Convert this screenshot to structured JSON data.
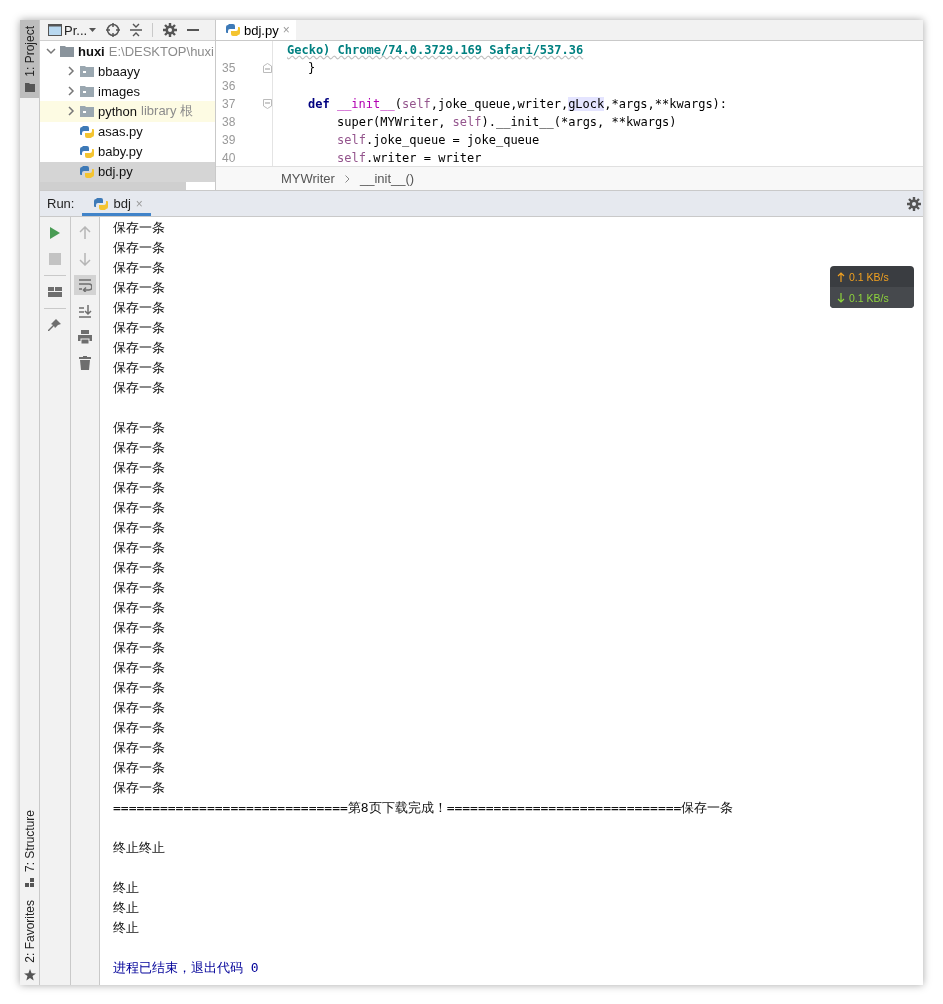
{
  "side_strip": {
    "top": [
      {
        "label": "1: Project",
        "selected": true
      }
    ],
    "bottom": [
      {
        "label": "7: Structure",
        "selected": false
      },
      {
        "label": "2: Favorites",
        "selected": false
      }
    ]
  },
  "project_panel": {
    "title": "Pr...",
    "tree": [
      {
        "name": "huxi",
        "path": "E:\\DESKTOP\\huxi",
        "kind": "folder",
        "expanded": true,
        "selected": false,
        "highlighted": false,
        "children": [
          {
            "name": "bbaayy",
            "kind": "folder",
            "expanded": false,
            "selected": false,
            "highlighted": false
          },
          {
            "name": "images",
            "kind": "folder",
            "expanded": false,
            "selected": false,
            "highlighted": false
          },
          {
            "name": "python",
            "note": "library 根",
            "kind": "folder",
            "expanded": false,
            "selected": false,
            "highlighted": true
          },
          {
            "name": "asas.py",
            "kind": "python-file",
            "selected": false,
            "highlighted": false
          },
          {
            "name": "baby.py",
            "kind": "python-file",
            "selected": false,
            "highlighted": false
          },
          {
            "name": "bdj.py",
            "kind": "python-file",
            "selected": true,
            "highlighted": false
          }
        ]
      }
    ]
  },
  "editor": {
    "tab": {
      "label": "bdj.py",
      "close": "×"
    },
    "lines": [
      {
        "kind": "continuation",
        "tokens": [
          {
            "kind": "string",
            "text": "Gecko) Chrome/74.0.3729.169 Safari/537.36"
          }
        ]
      },
      {
        "number": "35",
        "kind": "block-end",
        "tokens": [
          {
            "kind": "plain",
            "text": "}"
          }
        ]
      },
      {
        "number": "36",
        "kind": "blank"
      },
      {
        "number": "37",
        "kind": "def",
        "tokens": [
          {
            "kind": "keyword",
            "text": "def "
          },
          {
            "kind": "magic",
            "text": "__init__"
          },
          {
            "kind": "plain",
            "text": "("
          },
          {
            "kind": "self",
            "text": "self"
          },
          {
            "kind": "plain",
            "text": ",joke_queue,writer,"
          },
          {
            "kind": "highlight",
            "text": "gLock"
          },
          {
            "kind": "plain",
            "text": ",*args,**kwargs):"
          }
        ]
      },
      {
        "number": "38",
        "kind": "body",
        "tokens": [
          {
            "kind": "plain",
            "text": "super(MYWriter, "
          },
          {
            "kind": "self",
            "text": "self"
          },
          {
            "kind": "plain",
            "text": ").__init__(*args, **kwargs)"
          }
        ]
      },
      {
        "number": "39",
        "kind": "body",
        "tokens": [
          {
            "kind": "self",
            "text": "self"
          },
          {
            "kind": "plain",
            "text": ".joke_queue = joke_queue"
          }
        ]
      },
      {
        "number": "40",
        "kind": "body",
        "tokens": [
          {
            "kind": "self",
            "text": "self"
          },
          {
            "kind": "plain",
            "text": ".writer = writer"
          }
        ]
      }
    ],
    "breadcrumbs": [
      "MYWriter",
      "__init__()"
    ]
  },
  "run_panel": {
    "label": "Run:",
    "tab": {
      "label": "bdj",
      "close": "×",
      "selected": true
    },
    "tools_left": [
      {
        "kind": "run",
        "disabled": false
      },
      {
        "kind": "stop",
        "disabled": true
      },
      {
        "kind": "layout",
        "disabled": false
      },
      {
        "kind": "pin",
        "disabled": false
      }
    ],
    "tools_right": [
      {
        "kind": "up",
        "disabled": true,
        "on": false
      },
      {
        "kind": "down",
        "disabled": true,
        "on": false
      },
      {
        "kind": "wrap",
        "disabled": false,
        "on": true
      },
      {
        "kind": "scroll-end",
        "disabled": false,
        "on": false
      },
      {
        "kind": "print",
        "disabled": false,
        "on": false
      },
      {
        "kind": "trash",
        "disabled": false,
        "on": false
      }
    ],
    "output": [
      {
        "kind": "normal",
        "text": "保存一条"
      },
      {
        "kind": "normal",
        "text": "保存一条"
      },
      {
        "kind": "normal",
        "text": "保存一条"
      },
      {
        "kind": "normal",
        "text": "保存一条"
      },
      {
        "kind": "normal",
        "text": "保存一条"
      },
      {
        "kind": "normal",
        "text": "保存一条"
      },
      {
        "kind": "normal",
        "text": "保存一条"
      },
      {
        "kind": "normal",
        "text": "保存一条"
      },
      {
        "kind": "normal",
        "text": "保存一条"
      },
      {
        "kind": "blank"
      },
      {
        "kind": "normal",
        "text": "保存一条"
      },
      {
        "kind": "normal",
        "text": "保存一条"
      },
      {
        "kind": "normal",
        "text": "保存一条"
      },
      {
        "kind": "normal",
        "text": "保存一条"
      },
      {
        "kind": "normal",
        "text": "保存一条"
      },
      {
        "kind": "normal",
        "text": "保存一条"
      },
      {
        "kind": "normal",
        "text": "保存一条"
      },
      {
        "kind": "normal",
        "text": "保存一条"
      },
      {
        "kind": "normal",
        "text": "保存一条"
      },
      {
        "kind": "normal",
        "text": "保存一条"
      },
      {
        "kind": "normal",
        "text": "保存一条"
      },
      {
        "kind": "normal",
        "text": "保存一条"
      },
      {
        "kind": "normal",
        "text": "保存一条"
      },
      {
        "kind": "normal",
        "text": "保存一条"
      },
      {
        "kind": "normal",
        "text": "保存一条"
      },
      {
        "kind": "normal",
        "text": "保存一条"
      },
      {
        "kind": "normal",
        "text": "保存一条"
      },
      {
        "kind": "normal",
        "text": "保存一条"
      },
      {
        "kind": "normal",
        "text": "保存一条"
      },
      {
        "kind": "normal",
        "text": "==============================第8页下载完成！==============================保存一条"
      },
      {
        "kind": "blank"
      },
      {
        "kind": "normal",
        "text": "终止终止"
      },
      {
        "kind": "blank"
      },
      {
        "kind": "normal",
        "text": "终止"
      },
      {
        "kind": "normal",
        "text": "终止"
      },
      {
        "kind": "normal",
        "text": "终止"
      },
      {
        "kind": "blank"
      },
      {
        "kind": "exit",
        "text": "进程已结束，退出代码 0"
      }
    ]
  },
  "network_widget": {
    "upload": "0.1 KB/s",
    "download": "0.1 KB/s"
  }
}
